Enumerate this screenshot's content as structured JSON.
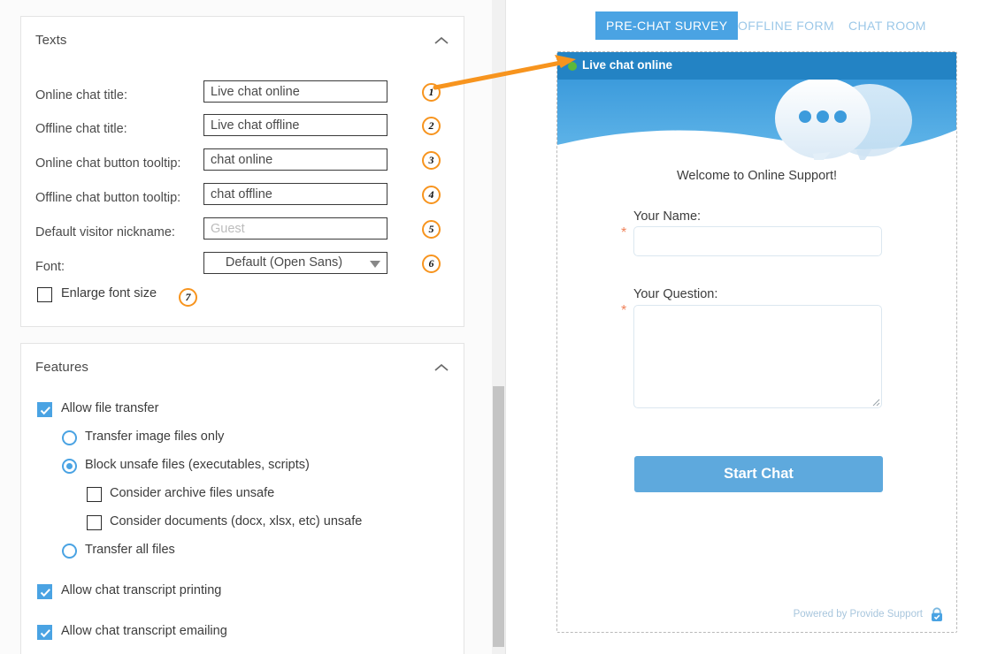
{
  "settings": {
    "texts_panel": {
      "title": "Texts",
      "collapse_icon": "chevron-up-icon",
      "fields": [
        {
          "label": "Online chat title:",
          "value": "Live chat online",
          "placeholder": "",
          "badge": "1",
          "type": "text"
        },
        {
          "label": "Offline chat title:",
          "value": "Live chat offline",
          "placeholder": "",
          "badge": "2",
          "type": "text"
        },
        {
          "label": "Online chat button tooltip:",
          "value": "chat online",
          "placeholder": "",
          "badge": "3",
          "type": "text"
        },
        {
          "label": "Offline chat button tooltip:",
          "value": "chat offline",
          "placeholder": "",
          "badge": "4",
          "type": "text"
        },
        {
          "label": "Default visitor nickname:",
          "value": "",
          "placeholder": "Guest",
          "badge": "5",
          "type": "text"
        },
        {
          "label": "Font:",
          "value": "Default (Open Sans)",
          "placeholder": "",
          "badge": "6",
          "type": "select"
        }
      ],
      "enlarge_font": {
        "label": "Enlarge font size",
        "checked": false,
        "badge": "7"
      }
    },
    "features_panel": {
      "title": "Features",
      "collapse_icon": "chevron-up-icon",
      "items": [
        {
          "label": "Allow file transfer",
          "control": "checkbox",
          "checked": true,
          "indent": 0
        },
        {
          "label": "Transfer image files only",
          "control": "radio",
          "checked": false,
          "indent": 1
        },
        {
          "label": "Block unsafe files (executables, scripts)",
          "control": "radio",
          "checked": true,
          "indent": 1
        },
        {
          "label": "Consider archive files unsafe",
          "control": "checkbox",
          "checked": false,
          "indent": 2
        },
        {
          "label": "Consider documents (docx, xlsx, etc) unsafe",
          "control": "checkbox",
          "checked": false,
          "indent": 2
        },
        {
          "label": "Transfer all files",
          "control": "radio",
          "checked": false,
          "indent": 1
        },
        {
          "label": "Allow chat transcript printing",
          "control": "checkbox",
          "checked": true,
          "indent": 0
        },
        {
          "label": "Allow chat transcript emailing",
          "control": "checkbox",
          "checked": true,
          "indent": 0
        }
      ]
    }
  },
  "preview": {
    "tabs": [
      {
        "label": "PRE-CHAT SURVEY",
        "active": true
      },
      {
        "label": "OFFLINE FORM",
        "active": false
      },
      {
        "label": "CHAT ROOM",
        "active": false
      }
    ],
    "widget": {
      "title": "Live chat online",
      "status_icon": "online-status-dot",
      "banner_icon": "speech-bubbles-icon",
      "welcome": "Welcome to Online Support!",
      "name_label": "Your Name:",
      "name_value": "",
      "question_label": "Your Question:",
      "question_value": "",
      "required_marker": "*",
      "submit_label": "Start Chat",
      "footer_text": "Powered by Provide Support",
      "footer_icon": "lock-icon"
    }
  },
  "colors": {
    "accent_blue": "#4aa3e3",
    "title_blue": "#2383c4",
    "button_blue": "#5ea9dd",
    "callout_orange": "#f7941e",
    "required_orange": "#f0825a",
    "status_green": "#5cb83b"
  }
}
